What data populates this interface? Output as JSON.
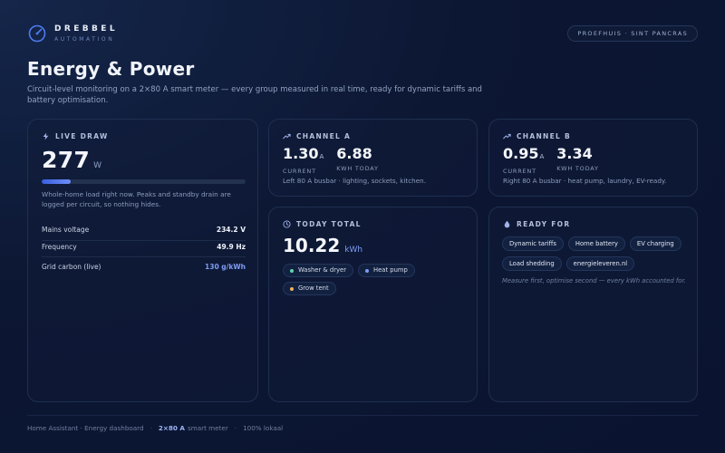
{
  "brand": {
    "name": "DREBBEL",
    "subtitle": "AUTOMATION"
  },
  "location": "PROEFHUIS · SINT PANCRAS",
  "page": {
    "title": "Energy & Power",
    "subtitle": "Circuit-level monitoring on a 2×80 A smart meter — every group measured in real time, ready for dynamic tariffs and battery optimisation."
  },
  "live_draw": {
    "label": "LIVE DRAW",
    "value": "277",
    "unit": "W",
    "load_fraction": 0.14,
    "description": "Whole-home load right now. Peaks and standby drain are logged per circuit, so nothing hides.",
    "stats": [
      {
        "key": "Mains voltage",
        "value": "234.2 V",
        "accent": false
      },
      {
        "key": "Frequency",
        "value": "49.9 Hz",
        "accent": false
      },
      {
        "key": "Grid carbon (live)",
        "value": "130 g/kWh",
        "accent": true
      }
    ]
  },
  "channel_a": {
    "label": "CHANNEL A",
    "current": "1.30",
    "current_unit": "A",
    "current_caption": "CURRENT",
    "kwh": "6.88",
    "kwh_caption": "KWH TODAY",
    "description": "Left 80 A busbar · lighting, sockets, kitchen."
  },
  "channel_b": {
    "label": "CHANNEL B",
    "current": "0.95",
    "current_unit": "A",
    "current_caption": "CURRENT",
    "kwh": "3.34",
    "kwh_caption": "KWH TODAY",
    "description": "Right 80 A busbar · heat pump, laundry, EV-ready."
  },
  "today_total": {
    "label": "TODAY TOTAL",
    "value": "10.22",
    "unit": "kWh",
    "chips": [
      {
        "label": "Washer & dryer",
        "color": "#5fd4a8"
      },
      {
        "label": "Heat pump",
        "color": "#7f9cf5"
      },
      {
        "label": "Grow tent",
        "color": "#f0b35a"
      }
    ]
  },
  "ready_for": {
    "label": "READY FOR",
    "tags": [
      "Dynamic tariffs",
      "Home battery",
      "EV charging",
      "Load shedding",
      "energieleveren.nl"
    ],
    "note": "Measure first, optimise second — every kWh accounted for."
  },
  "footer": {
    "part1": "Home Assistant · Energy dashboard",
    "meter_strong": "2×80 A",
    "meter_rest": "smart meter",
    "part3": "100% lokaal"
  },
  "icons": {
    "brand": "gauge-icon",
    "live": "bolt-icon",
    "channel": "trend-up-icon",
    "today": "clock-icon",
    "ready": "drop-icon"
  },
  "colors": {
    "accent": "#7f9cf5",
    "background": "#0c1733"
  }
}
